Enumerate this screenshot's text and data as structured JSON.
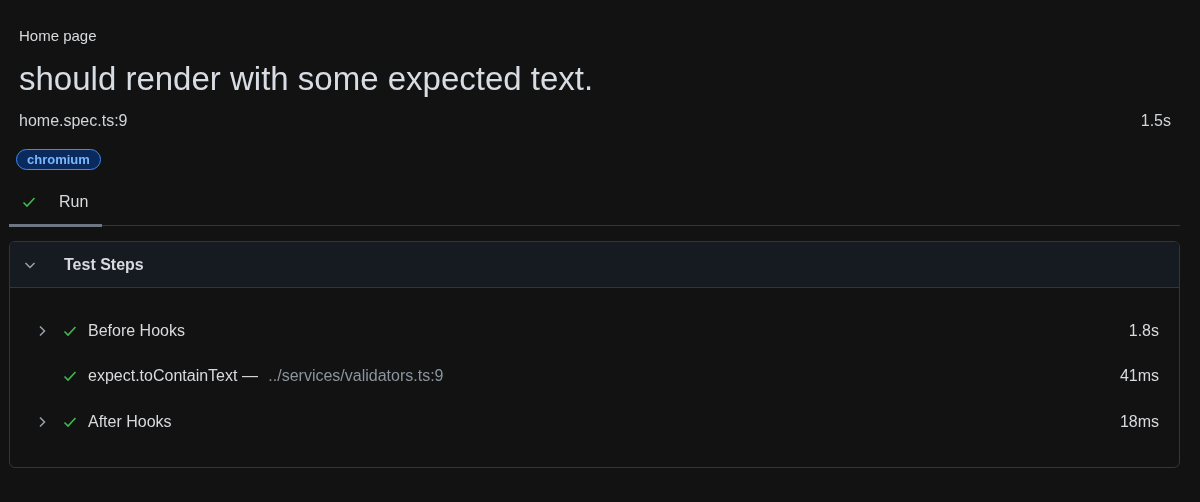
{
  "breadcrumb": "Home page",
  "title": "should render with some expected text.",
  "location": "home.spec.ts:9",
  "duration": "1.5s",
  "tags": [
    "chromium"
  ],
  "tabs": [
    {
      "label": "Run",
      "kind": "passed",
      "selected": true
    }
  ],
  "steps_section": {
    "title": "Test Steps",
    "expanded": true,
    "steps": [
      {
        "title": "Before Hooks",
        "duration": "1.8s",
        "kind": "passed",
        "expandable": true
      },
      {
        "title": "expect.toContainText",
        "separator": "—",
        "location": "../services/validators.ts:9",
        "duration": "41ms",
        "kind": "passed",
        "expandable": false
      },
      {
        "title": "After Hooks",
        "duration": "18ms",
        "kind": "passed",
        "expandable": true
      }
    ]
  }
}
